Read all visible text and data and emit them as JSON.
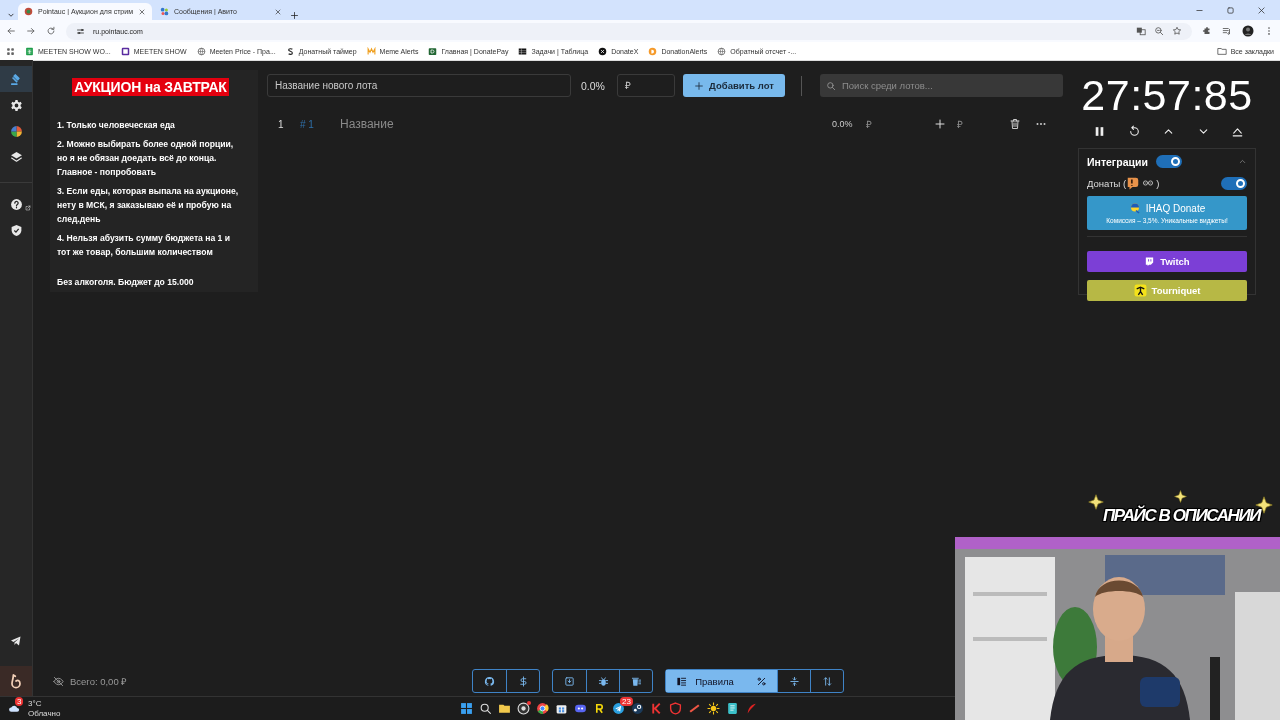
{
  "browser": {
    "tabs": [
      {
        "title": "Pointauc | Аукцион для стрим",
        "selected": true
      },
      {
        "title": "Сообщения | Авито",
        "selected": false
      }
    ],
    "address": "ru.pointauc.com",
    "bookmarks": [
      {
        "kind": "sheet",
        "label": "MEETEN SHOW WO..."
      },
      {
        "kind": "frame",
        "label": "MEETEN SHOW"
      },
      {
        "kind": "globe",
        "label": "Meeten Price - Пра..."
      },
      {
        "kind": "s",
        "label": "Донатный таймер"
      },
      {
        "kind": "m",
        "label": "Meme Alerts"
      },
      {
        "kind": "pay",
        "label": "Главная | DonatePay"
      },
      {
        "kind": "table",
        "label": "Задачи | Таблица"
      },
      {
        "kind": "x",
        "label": "DonateX"
      },
      {
        "kind": "da",
        "label": "DonationAlerts"
      },
      {
        "kind": "globe",
        "label": "Обратный отсчет -..."
      }
    ],
    "all_bookmarks": "Все закладки"
  },
  "sidebar": {
    "items": [
      {
        "kind": "gavel",
        "selected": true
      },
      {
        "kind": "settings",
        "selected": false
      },
      {
        "kind": "chart",
        "selected": false
      },
      {
        "kind": "layers",
        "selected": false
      },
      {
        "kind": "help",
        "selected": false
      },
      {
        "kind": "shield",
        "selected": false
      }
    ],
    "bottom_items": [
      {
        "kind": "telegram"
      },
      {
        "kind": "logo"
      }
    ]
  },
  "rules": {
    "title": "АУКЦИОН на ЗАВТРАК",
    "items": [
      "1. Только человеческая еда",
      "2. Можно выбирать более одной порции, но я не обязан доедать всё до конца. Главное - попробовать",
      "3. Если еды, которая выпала на аукционе, нету в МСК, я заказываю её и пробую на след.день",
      "4. Нельзя абузить сумму бюджета на 1 и тот же товар, большим количеством"
    ],
    "footer": "Без алкоголя. Бюджет до 15.000"
  },
  "new_lot": {
    "placeholder": "Название нового лота",
    "percent": "0.0%",
    "amount_placeholder": "₽",
    "add_button": "Добавить лот"
  },
  "search": {
    "placeholder": "Поиск среди лотов..."
  },
  "lots": [
    {
      "index": "1",
      "id": "# 1",
      "name_placeholder": "Название",
      "percent": "0.0%",
      "amount_placeholder": "₽",
      "add_placeholder": "₽"
    }
  ],
  "timer": {
    "time": "27:57:85"
  },
  "integrations": {
    "title": "Интеграции",
    "on": true,
    "expanded": true,
    "donations": {
      "label_open": "Донаты (",
      "label_close": ")",
      "on": true
    },
    "services": [
      {
        "kind": "ihaq",
        "title": "IHAQ Donate",
        "subtitle": "Комиссия – 3,5%. Уникальные виджеты!"
      },
      {
        "kind": "twitch",
        "title": "Twitch"
      },
      {
        "kind": "tourniquet",
        "title": "Tourniquet"
      }
    ]
  },
  "bottom_bar": {
    "total": "Всего: 0,00 ₽",
    "toolbar_groups": [
      [
        {
          "kind": "github",
          "selected": false
        },
        {
          "kind": "dollar",
          "selected": false
        }
      ],
      [
        {
          "kind": "save",
          "selected": false
        },
        {
          "kind": "bug",
          "selected": false
        },
        {
          "kind": "clear",
          "selected": false
        }
      ],
      [
        {
          "kind": "rules",
          "label": "Правила",
          "selected": true
        },
        {
          "kind": "percent",
          "selected": true
        },
        {
          "kind": "split",
          "selected": false
        },
        {
          "kind": "sort",
          "selected": false
        }
      ]
    ]
  },
  "taskbar": {
    "weather": {
      "badge": "3",
      "temperature": "3°C",
      "condition": "Облачно"
    },
    "apps": [
      {
        "kind": "windows"
      },
      {
        "kind": "search"
      },
      {
        "kind": "folder"
      },
      {
        "kind": "obs",
        "alert": true
      },
      {
        "kind": "chrome"
      },
      {
        "kind": "store"
      },
      {
        "kind": "discord"
      },
      {
        "kind": "r"
      },
      {
        "kind": "telegram",
        "badge": "23"
      },
      {
        "kind": "steam"
      },
      {
        "kind": "k"
      },
      {
        "kind": "shield"
      },
      {
        "kind": "slash"
      },
      {
        "kind": "sun"
      },
      {
        "kind": "notes"
      },
      {
        "kind": "red"
      }
    ]
  },
  "stream_overlay": {
    "banner": "ПРАЙС В ОПИСАНИИ"
  }
}
